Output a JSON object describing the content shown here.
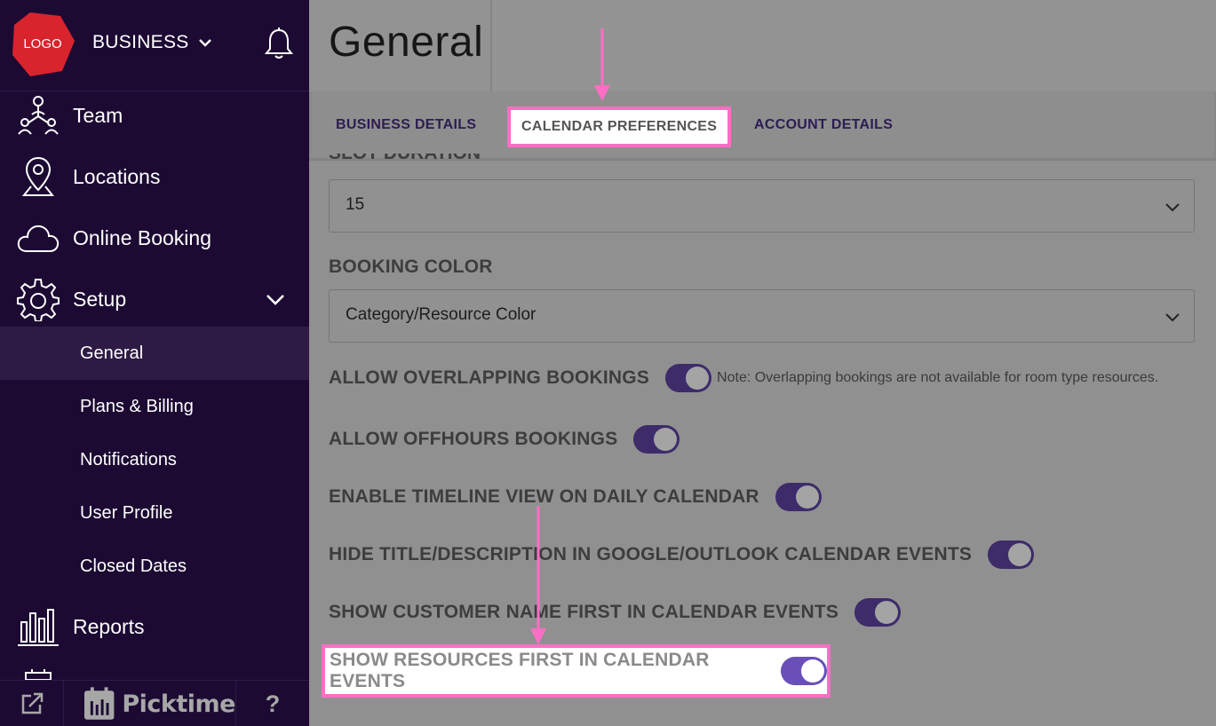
{
  "sidebar": {
    "logo_text": "LOGO",
    "business_label": "BUSINESS",
    "nav": [
      {
        "label": "Team",
        "icon": "team-icon"
      },
      {
        "label": "Locations",
        "icon": "location-pin-icon"
      },
      {
        "label": "Online Booking",
        "icon": "cloud-icon"
      },
      {
        "label": "Setup",
        "icon": "gear-icon"
      }
    ],
    "setup_sub": [
      "General",
      "Plans & Billing",
      "Notifications",
      "User Profile",
      "Closed Dates"
    ],
    "reports_label": "Reports",
    "footer": {
      "brand": "Picktime",
      "help": "?"
    }
  },
  "main": {
    "title": "General",
    "tabs": [
      "BUSINESS DETAILS",
      "CALENDAR PREFERENCES",
      "ACCOUNT DETAILS"
    ],
    "active_tab": "CALENDAR PREFERENCES",
    "slot_duration_label": "SLOT DURATION",
    "slot_duration_value": "15",
    "booking_color_label": "BOOKING COLOR",
    "booking_color_value": "Category/Resource Color",
    "toggles": [
      {
        "label": "ALLOW OVERLAPPING BOOKINGS",
        "on": true,
        "note": "Note: Overlapping bookings are not available for room type resources."
      },
      {
        "label": "ALLOW OFFHOURS BOOKINGS",
        "on": true
      },
      {
        "label": "ENABLE TIMELINE VIEW ON DAILY CALENDAR",
        "on": true
      },
      {
        "label": "HIDE TITLE/DESCRIPTION IN GOOGLE/OUTLOOK CALENDAR EVENTS",
        "on": true
      },
      {
        "label": "SHOW CUSTOMER NAME FIRST IN CALENDAR EVENTS",
        "on": true
      },
      {
        "label": "SHOW RESOURCES FIRST IN CALENDAR EVENTS",
        "on": true
      }
    ]
  },
  "colors": {
    "sidebar_bg": "#1c0a33",
    "highlight": "#ff6ec4",
    "toggle_on": "#6a4fb8",
    "logo_red": "#d9232d"
  }
}
